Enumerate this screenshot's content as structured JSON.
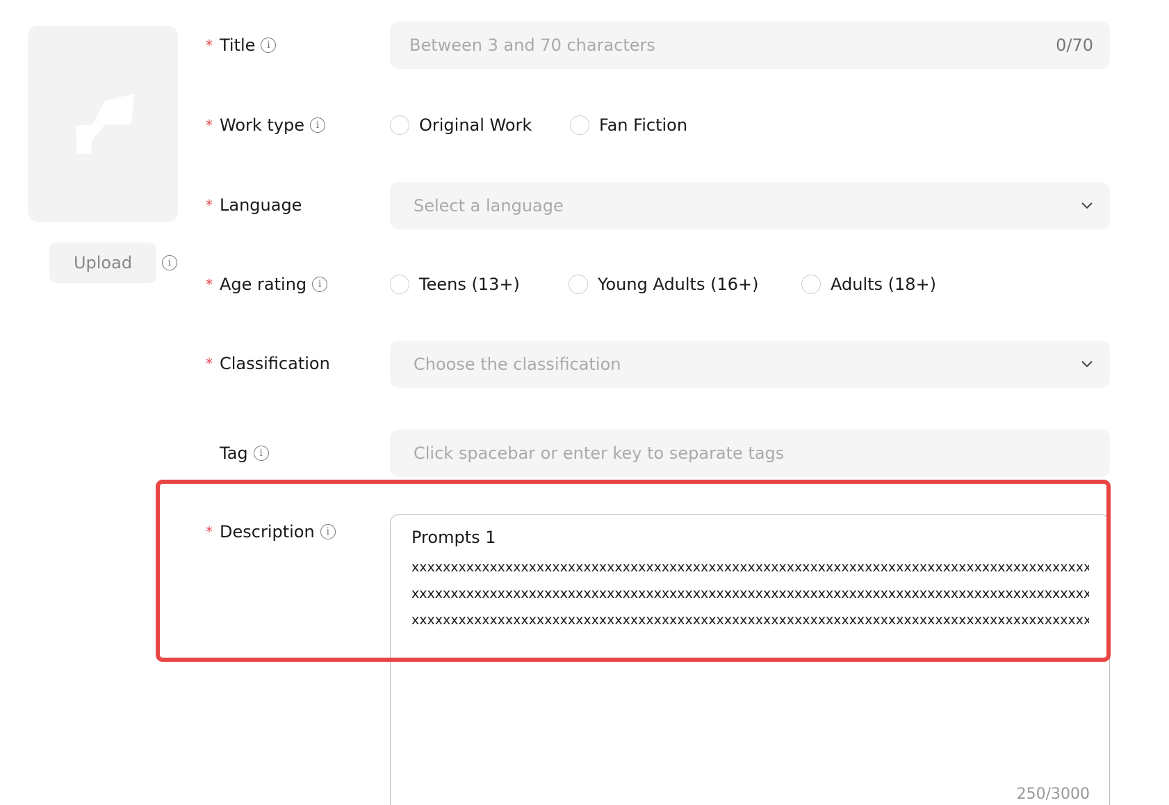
{
  "cover": {
    "icon": "image-placeholder-icon",
    "upload_label": "Upload"
  },
  "fields": {
    "title": {
      "label": "Title",
      "placeholder": "Between 3 and 70 characters",
      "counter": "0/70"
    },
    "work_type": {
      "label": "Work type",
      "options": [
        "Original Work",
        "Fan Fiction"
      ]
    },
    "language": {
      "label": "Language",
      "placeholder": "Select a language"
    },
    "age_rating": {
      "label": "Age rating",
      "options": [
        "Teens (13+)",
        "Young Adults (16+)",
        "Adults (18+)"
      ]
    },
    "classification": {
      "label": "Classification",
      "placeholder": "Choose the classification"
    },
    "tag": {
      "label": "Tag",
      "placeholder": "Click spacebar or enter key to separate tags"
    },
    "description": {
      "label": "Description",
      "lines": [
        "Prompts 1",
        "xxxxxxxxxxxxxxxxxxxxxxxxxxxxxxxxxxxxxxxxxxxxxxxxxxxxxxxxxxxxxxxxxxxxxxxxxxxxxxxxxxxxxxxxxxxxx",
        "xxxxxxxxxxxxxxxxxxxxxxxxxxxxxxxxxxxxxxxxxxxxxxxxxxxxxxxxxxxxxxxxxxxxxxxxxxxxxxxxxxxxxxxxxxxxx",
        "xxxxxxxxxxxxxxxxxxxxxxxxxxxxxxxxxxxxxxxxxxxxxxxxxxxxxxxxxxxxxxxxxxxxxxxxxxxxxxxxxxxxxxxxxxxxx"
      ],
      "counter": "250/3000"
    }
  },
  "required_mark": "*",
  "info_glyph": "i",
  "colors": {
    "required": "#e5484d",
    "highlight": "#e84545"
  }
}
